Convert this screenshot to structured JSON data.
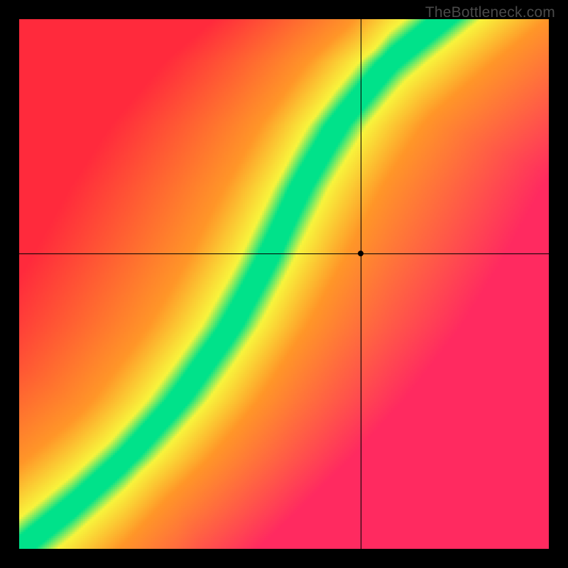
{
  "watermark": "TheBottleneck.com",
  "chart_data": {
    "type": "heatmap",
    "title": "",
    "xlabel": "",
    "ylabel": "",
    "xlim": [
      0,
      1
    ],
    "ylim": [
      0,
      1
    ],
    "crosshair": {
      "x": 0.645,
      "y": 0.557
    },
    "optimal_curve": {
      "description": "green optimal band following an S-curve from bottom-left to top-right",
      "points": [
        {
          "x": 0.0,
          "y": 0.0
        },
        {
          "x": 0.1,
          "y": 0.08
        },
        {
          "x": 0.2,
          "y": 0.17
        },
        {
          "x": 0.3,
          "y": 0.28
        },
        {
          "x": 0.4,
          "y": 0.42
        },
        {
          "x": 0.47,
          "y": 0.55
        },
        {
          "x": 0.53,
          "y": 0.68
        },
        {
          "x": 0.6,
          "y": 0.8
        },
        {
          "x": 0.7,
          "y": 0.92
        },
        {
          "x": 0.8,
          "y": 1.0
        }
      ],
      "band_half_width": 0.04
    },
    "color_scale": {
      "optimal": "#00E28A",
      "near": "#F4F442",
      "mid": "#FF9B2B",
      "far_upper": "#FF2A3C",
      "far_lower": "#FF2A60"
    }
  }
}
